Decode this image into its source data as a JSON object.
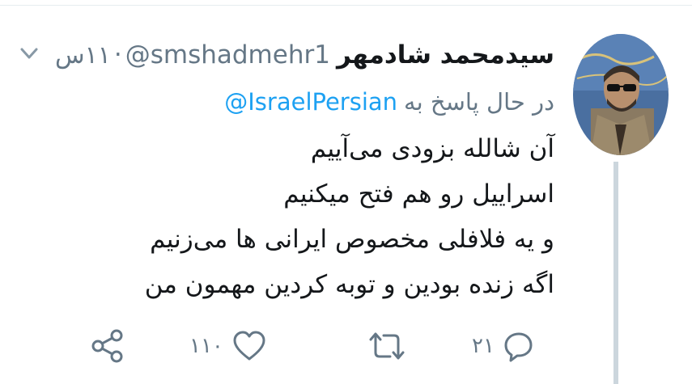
{
  "tweet": {
    "display_name": "سیدمحمد شادمهر",
    "username": "@smshadmehr1",
    "separator": "·",
    "time": "۱۱س",
    "reply_prefix": "در حال پاسخ به",
    "reply_to": "@IsraelPersian",
    "lines": [
      "آن شالله بزودی می‌آییم",
      "اسراییل رو هم فتح میکنیم",
      "و یه فلافلی مخصوص ایرانی ها می‌زنیم",
      "اگه زنده بودین و توبه کردین مهمون من"
    ]
  },
  "actions": {
    "reply": {
      "icon": "reply-icon",
      "count": "۲۱"
    },
    "retweet": {
      "icon": "retweet-icon",
      "count": ""
    },
    "like": {
      "icon": "heart-icon",
      "count": "۱۱۰"
    },
    "share": {
      "icon": "share-icon"
    }
  },
  "menu": {
    "icon": "chevron-down-icon"
  },
  "colors": {
    "text": "#14171a",
    "muted": "#657786",
    "link": "#1da1f2",
    "thread_line": "#ccd6dd",
    "divider": "#e6ecf0"
  }
}
